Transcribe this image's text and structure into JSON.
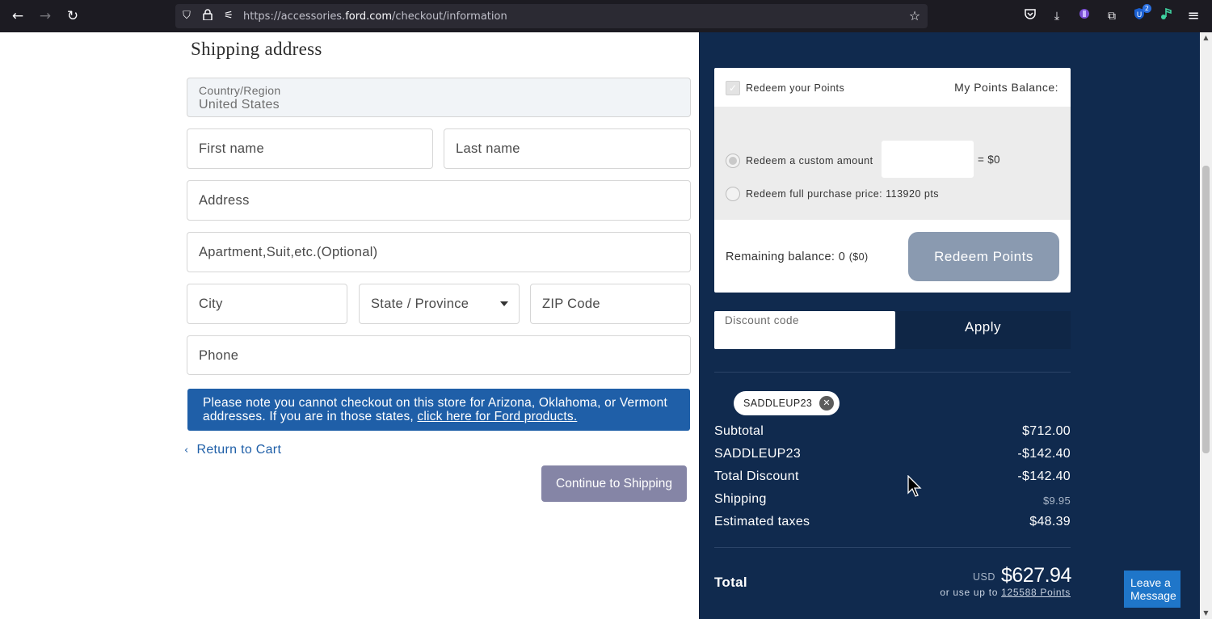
{
  "browser": {
    "url_prefix": "https://accessories.",
    "url_domain": "ford.com",
    "url_path": "/checkout/information",
    "ext_badge": "2"
  },
  "form": {
    "title": "Shipping address",
    "country_label": "Country/Region",
    "country_value": "United States",
    "first_name": "First name",
    "last_name": "Last name",
    "address": "Address",
    "apartment": "Apartment,Suit,etc.(Optional)",
    "city": "City",
    "state": "State / Province",
    "zip": "ZIP Code",
    "phone": "Phone",
    "notice_text": "Please note you cannot checkout on this store for Arizona, Oklahoma, or Vermont addresses. If you are in those states,",
    "notice_link": "click here for Ford products.",
    "return_link": "Return to Cart",
    "continue_button": "Continue to Shipping"
  },
  "points": {
    "redeem_label": "Redeem your Points",
    "balance_label": "My Points Balance:",
    "custom_amount_label": "Redeem a custom amount",
    "custom_amount_equals": "= $0",
    "full_price_label": "Redeem full purchase price: 113920 pts",
    "remaining_label": "Remaining balance: 0",
    "remaining_dollars": "($0)",
    "redeem_button": "Redeem Points"
  },
  "discount": {
    "placeholder": "Discount code",
    "apply_button": "Apply",
    "applied_code": "SADDLEUP23"
  },
  "summary": {
    "rows": [
      {
        "label": "Subtotal",
        "value": "$712.00"
      },
      {
        "label": "SADDLEUP23",
        "value": "-$142.40"
      },
      {
        "label": "Total Discount",
        "value": "-$142.40"
      },
      {
        "label": "Shipping",
        "value": "$9.95"
      },
      {
        "label": "Estimated taxes",
        "value": "$48.39"
      }
    ],
    "total_label": "Total",
    "currency": "USD",
    "total_amount": "$627.94",
    "points_prefix": "or use up to",
    "points_link": "125588 Points"
  },
  "chat": {
    "label": "Leave a Message"
  },
  "icons": {
    "back": "←",
    "forward": "→",
    "reload": "↻",
    "shield": "⛉",
    "lock": "🔒",
    "permissions": "⚟",
    "star": "☆",
    "pocket": "◡",
    "download": "⤓",
    "extension": "⧉",
    "menu": "≡",
    "check": "✓",
    "chevron_left": "‹",
    "close": "✕",
    "scroll_up": "▲",
    "scroll_down": "▼"
  },
  "colors": {
    "summary_bg": "#102a4e",
    "notice_bg": "#1f5fa8",
    "continue_bg": "#8585a6",
    "redeem_bg": "#8a9ab0"
  }
}
